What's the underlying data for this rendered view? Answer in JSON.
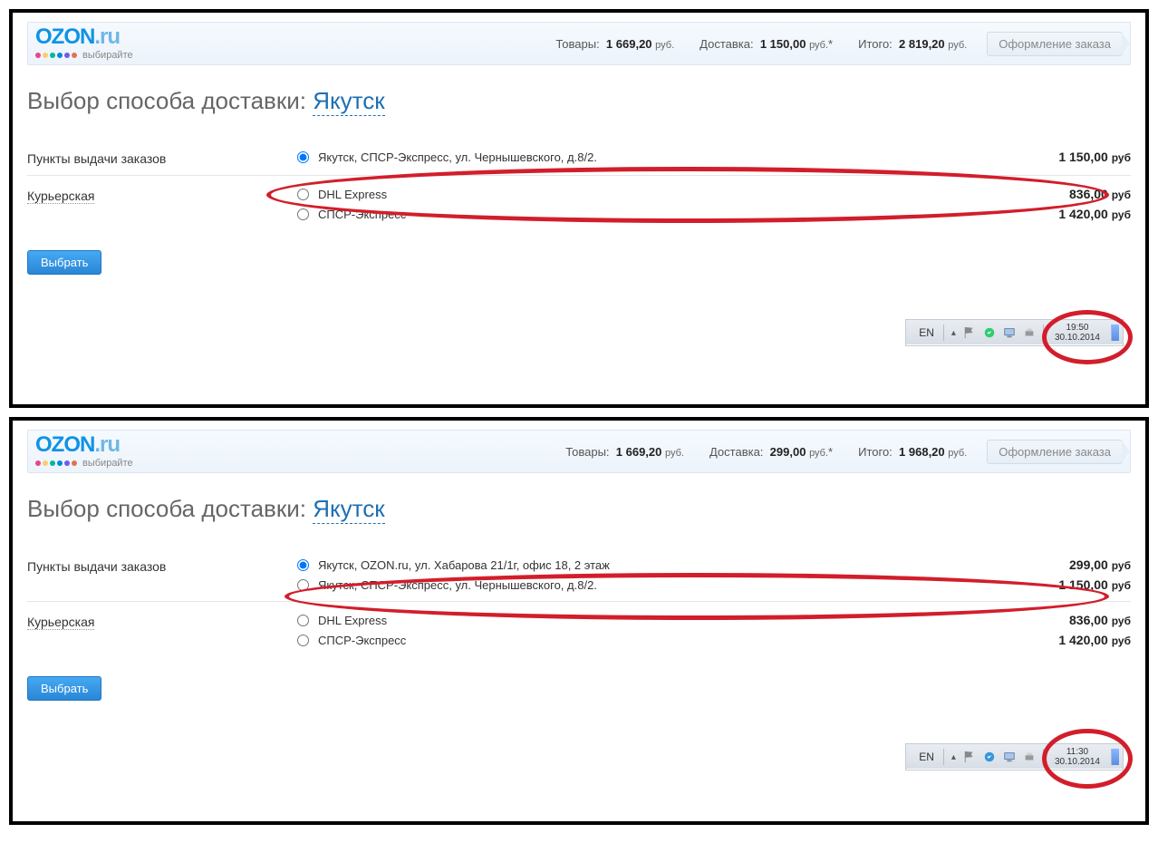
{
  "logo": {
    "main_ozon": "OZON",
    "main_ru": ".ru",
    "sub": "выбирайте"
  },
  "topbar_labels": {
    "goods": "Товары:",
    "delivery": "Доставка:",
    "total": "Итого:",
    "rub": "руб.",
    "checkout": "Оформление заказа"
  },
  "title_prefix": "Выбор способа доставки:",
  "city": "Якутск",
  "methods": {
    "pickup": "Пункты выдачи заказов",
    "courier": "Курьерская"
  },
  "select_label": "Выбрать",
  "tb_lang": "EN",
  "price_rub": "руб",
  "panels": [
    {
      "totals": {
        "goods": "1 669,20",
        "delivery": "1 150,00",
        "delivery_star": "*",
        "total": "2 819,20"
      },
      "pickup": [
        {
          "label": "Якутск, СПСР-Экспресс, ул. Чернышевского, д.8/2.",
          "price": "1 150,00",
          "selected": true
        }
      ],
      "courier": [
        {
          "label": "DHL Express",
          "price": "836,00"
        },
        {
          "label": "СПСР-Экспресс",
          "price": "1 420,00"
        }
      ],
      "clock": {
        "time": "19:50",
        "date": "30.10.2014"
      }
    },
    {
      "totals": {
        "goods": "1 669,20",
        "delivery": "299,00",
        "delivery_star": "*",
        "total": "1 968,20"
      },
      "pickup": [
        {
          "label": "Якутск, OZON.ru, ул. Хабарова 21/1г, офис 18, 2 этаж",
          "price": "299,00",
          "selected": true
        },
        {
          "label": "Якутск, СПСР-Экспресс, ул. Чернышевского, д.8/2.",
          "price": "1 150,00"
        }
      ],
      "courier": [
        {
          "label": "DHL Express",
          "price": "836,00"
        },
        {
          "label": "СПСР-Экспресс",
          "price": "1 420,00"
        }
      ],
      "clock": {
        "time": "11:30",
        "date": "30.10.2014"
      }
    }
  ]
}
